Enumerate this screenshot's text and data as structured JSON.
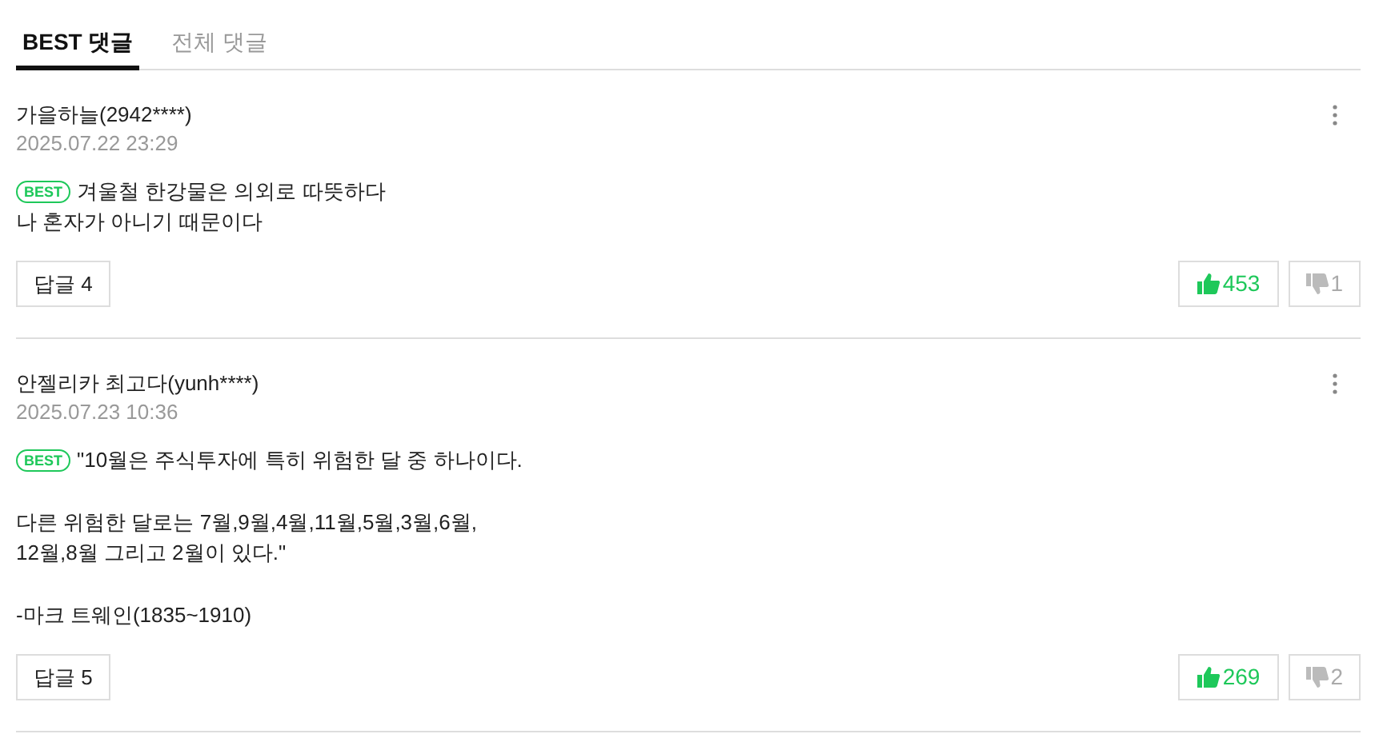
{
  "tabs": [
    {
      "label": "BEST 댓글",
      "selected": true
    },
    {
      "label": "전체 댓글",
      "selected": false
    }
  ],
  "comments": [
    {
      "author": "가을하늘(2942****)",
      "date": "2025.07.22 23:29",
      "badge": "BEST",
      "paragraphs": [
        [
          "겨울철 한강물은 의외로 따뜻하다",
          "나 혼자가 아니기 때문이다"
        ]
      ],
      "reply_button": "답글 4",
      "likes": "453",
      "dislikes": "1"
    },
    {
      "author": "안젤리카 최고다(yunh****)",
      "date": "2025.07.23 10:36",
      "badge": "BEST",
      "paragraphs": [
        [
          "\"10월은 주식투자에 특히 위험한 달 중 하나이다."
        ],
        [
          "다른 위험한 달로는 7월,9월,4월,11월,5월,3월,6월,",
          "12월,8월 그리고 2월이 있다.\""
        ],
        [
          "-마크 트웨인(1835~1910)"
        ]
      ],
      "reply_button": "답글 5",
      "likes": "269",
      "dislikes": "2"
    }
  ]
}
